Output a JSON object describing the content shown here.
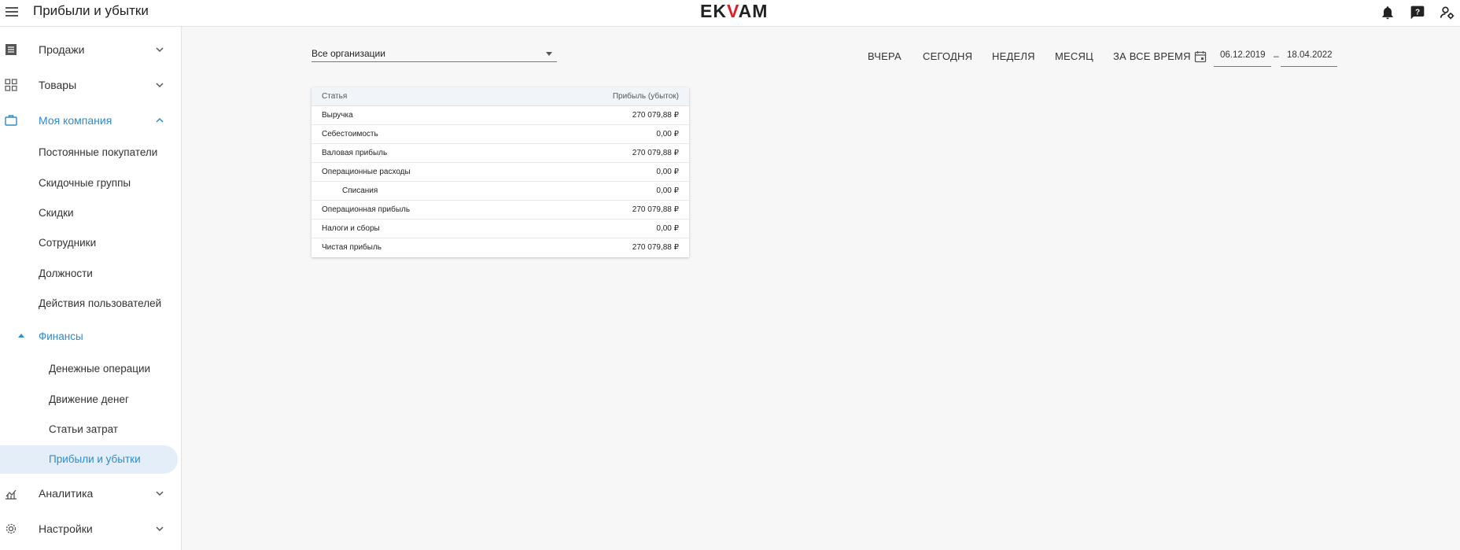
{
  "header": {
    "title": "Прибыли и убытки",
    "logo": {
      "prefix": "EK",
      "mark": "V",
      "suffix": "AM"
    },
    "icons": [
      "notification-bell-icon",
      "help-icon",
      "user-settings-icon"
    ]
  },
  "sidebar": {
    "items": [
      {
        "label": "Продажи",
        "icon": "list-icon"
      },
      {
        "label": "Товары",
        "icon": "grid-icon"
      },
      {
        "label": "Моя компания",
        "icon": "briefcase-icon"
      },
      {
        "label": "Аналитика",
        "icon": "chart-icon"
      },
      {
        "label": "Настройки",
        "icon": "gear-icon"
      }
    ],
    "company_items": [
      "Постоянные покупатели",
      "Скидочные группы",
      "Скидки",
      "Сотрудники",
      "Должности",
      "Действия пользователей"
    ],
    "finance_group": "Финансы",
    "finance_items": [
      "Денежные операции",
      "Движение денег",
      "Статьи затрат",
      "Прибыли и убытки"
    ]
  },
  "filters": {
    "organization": "Все организации",
    "periods": [
      "ВЧЕРА",
      "СЕГОДНЯ",
      "НЕДЕЛЯ",
      "МЕСЯЦ",
      "ЗА ВСЕ ВРЕМЯ"
    ],
    "date_from": "06.12.2019",
    "date_separator": "–",
    "date_to": "18.04.2022"
  },
  "report": {
    "columns": [
      "Статья",
      "Прибыль (убыток)"
    ],
    "rows": [
      {
        "label": "Выручка",
        "value": "270 079,88 ₽"
      },
      {
        "label": "Себестоимость",
        "value": "0,00 ₽"
      },
      {
        "label": "Валовая прибыль",
        "value": "270 079,88 ₽"
      },
      {
        "label": "Операционные расходы",
        "value": "0,00 ₽"
      },
      {
        "label": "Списания",
        "value": "0,00 ₽"
      },
      {
        "label": "Операционная прибыль",
        "value": "270 079,88 ₽"
      },
      {
        "label": "Налоги и сборы",
        "value": "0,00 ₽"
      },
      {
        "label": "Чистая прибыль",
        "value": "270 079,88 ₽"
      }
    ]
  },
  "colors": {
    "accent": "#2e8bc8",
    "selected_bg": "#e3eef8",
    "logo_red": "#d8232a"
  }
}
